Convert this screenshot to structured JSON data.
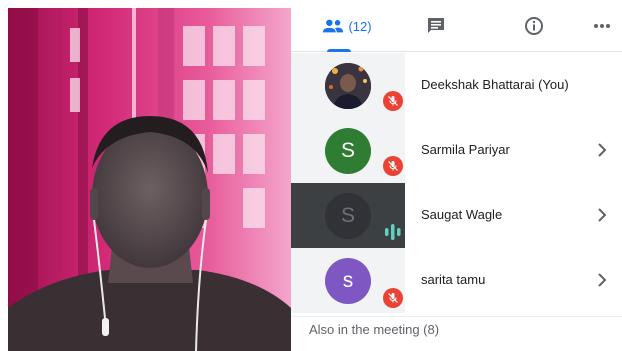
{
  "tabs": {
    "people_count": "(12)",
    "people_icon": "people-icon",
    "chat_icon": "chat-icon",
    "info_icon": "info-icon",
    "more_icon": "more-horizontal-icon",
    "accent": "#1a73e8"
  },
  "participants": [
    {
      "name": "Deekshak Bhattarai (You)",
      "initial": "",
      "avatar": "photo",
      "status": "muted"
    },
    {
      "name": "Sarmila Pariyar",
      "initial": "S",
      "avatar_color": "#2e7d32",
      "status": "muted"
    },
    {
      "name": "Saugat Wagle",
      "initial": "S",
      "avatar_color": "#313237",
      "status": "speaking"
    },
    {
      "name": "sarita tamu",
      "initial": "s",
      "avatar_color": "#7e57c2",
      "status": "muted"
    }
  ],
  "also_in_meeting": "Also in the meeting (8)",
  "colors": {
    "muted_badge": "#ea4335",
    "speaking": "#5fd0c1",
    "highlight_row": "#3c4043"
  }
}
